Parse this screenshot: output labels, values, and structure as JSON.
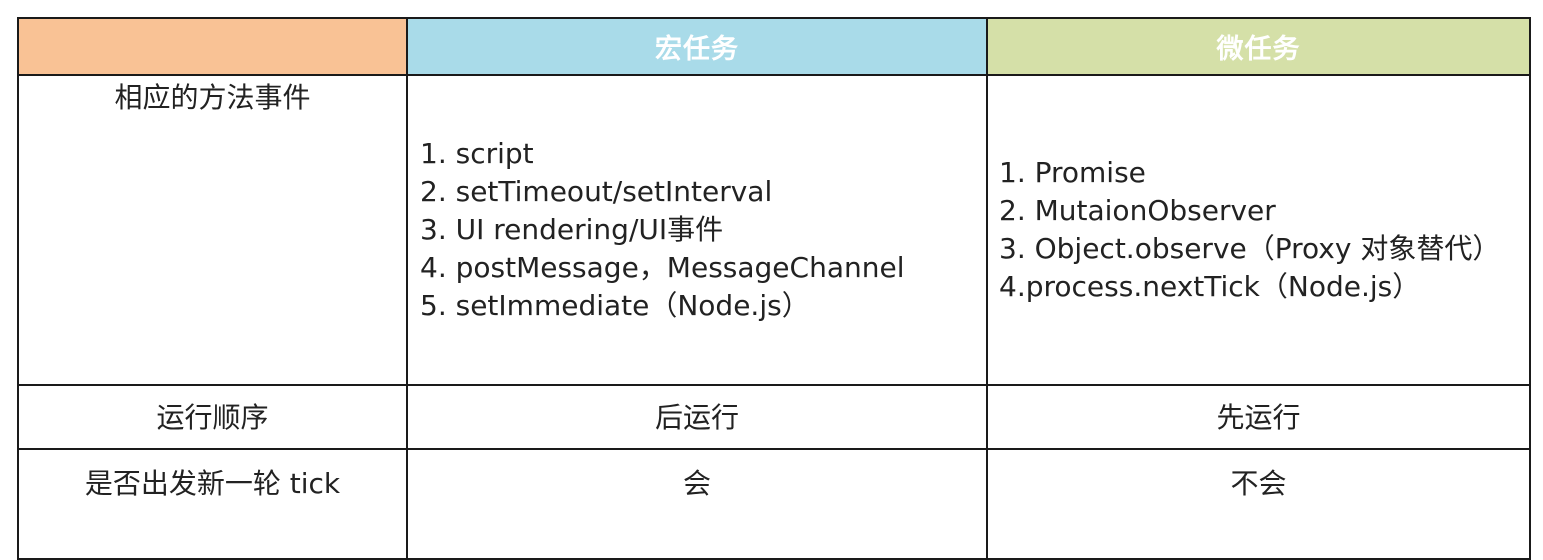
{
  "header": {
    "empty_label": "",
    "macro_label": "宏任务",
    "micro_label": "微任务"
  },
  "rows": {
    "methods": {
      "label": "相应的方法事件",
      "macro_items": [
        "1. script",
        "2. setTimeout/setInterval",
        "3. UI rendering/UI事件",
        "4. postMessage，MessageChannel",
        "5. setImmediate（Node.js）"
      ],
      "micro_items": [
        "1. Promise",
        "2. MutaionObserver",
        "3. Object.observe（Proxy 对象替代）",
        "4.process.nextTick（Node.js）"
      ]
    },
    "order": {
      "label": "运行顺序",
      "macro": "后运行",
      "micro": "先运行"
    },
    "new_tick": {
      "label": "是否出发新一轮 tick",
      "macro": "会",
      "micro": "不会"
    }
  },
  "colors": {
    "header_empty_bg": "#f9c295",
    "header_macro_bg": "#a9dbe9",
    "header_micro_bg": "#d5e0a8",
    "header_text": "#ffffff",
    "border": "#1a1a1a"
  }
}
